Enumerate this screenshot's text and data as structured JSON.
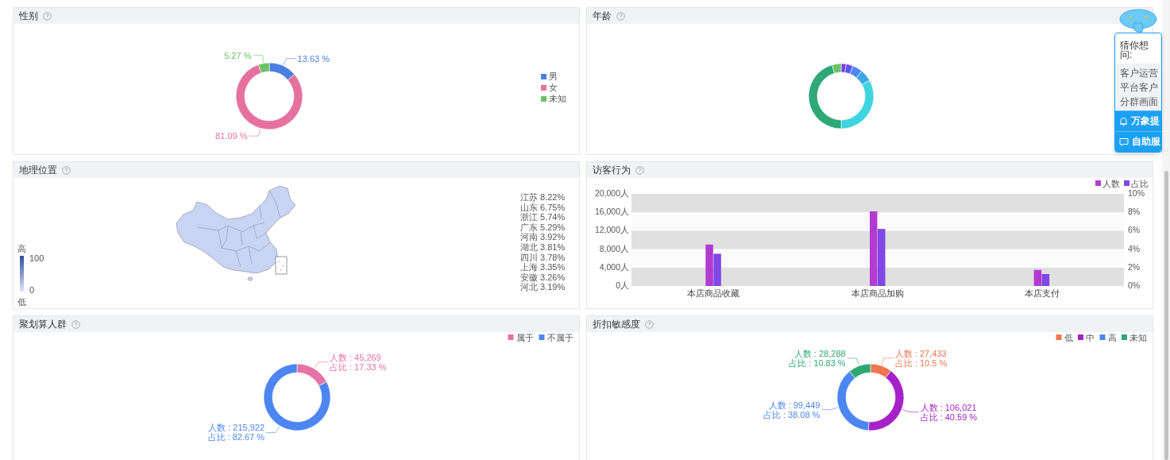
{
  "panels": [
    {
      "kind": "donut",
      "title": "性别",
      "chart_data": {
        "type": "donut",
        "legend": "right",
        "categories": [
          "男",
          "女",
          "未知"
        ],
        "values": [
          13.63,
          81.09,
          5.27
        ],
        "colors": [
          "#4a7fe0",
          "#e6719f",
          "#6cc165"
        ],
        "value_labels": [
          [
            "13.63 %"
          ],
          [
            "81.09 %"
          ],
          [
            "5.27 %"
          ]
        ]
      }
    },
    {
      "kind": "ring",
      "title": "年龄"
    },
    {
      "kind": "map",
      "title": "地理位置",
      "scale": {
        "high": "高",
        "low": "低",
        "max": "100",
        "min": "0"
      },
      "ranking": [
        "江苏 8.22%",
        "山东 6.75%",
        "浙江 5.74%",
        "广东 5.29%",
        "河南 3.92%",
        "湖北 3.81%",
        "四川 3.78%",
        "上海 3.35%",
        "安徽 3.26%",
        "河北 3.19%"
      ]
    },
    {
      "kind": "bar",
      "title": "访客行为",
      "chart_data": {
        "type": "bar",
        "legend": "top-right",
        "categories": [
          "本店商品收藏",
          "本店商品加购",
          "本店支付"
        ],
        "series": [
          {
            "name": "人数",
            "color": "#b23cd3",
            "values": [
              9000,
              16200,
              3500
            ]
          },
          {
            "name": "占比",
            "color": "#8047e6",
            "axis": "y2",
            "values": [
              3.5,
              6.2,
              1.3
            ]
          }
        ],
        "ylim": [
          0,
          20000
        ],
        "yticks": [
          {
            "value": 0,
            "label": "0人"
          },
          {
            "value": 4000,
            "label": "4,000人"
          },
          {
            "value": 8000,
            "label": "8,000人"
          },
          {
            "value": 12000,
            "label": "12,000人"
          },
          {
            "value": 16000,
            "label": "16,000人"
          },
          {
            "value": 20000,
            "label": "20,000人"
          }
        ],
        "y2lim": [
          0,
          10
        ],
        "y2ticks": [
          {
            "value": 0,
            "label": "0%"
          },
          {
            "value": 2,
            "label": "2%"
          },
          {
            "value": 4,
            "label": "4%"
          },
          {
            "value": 6,
            "label": "6%"
          },
          {
            "value": 8,
            "label": "8%"
          },
          {
            "value": 10,
            "label": "10%"
          }
        ]
      }
    },
    {
      "kind": "donut",
      "title": "聚划算人群",
      "chart_data": {
        "type": "donut",
        "legend": "top-right",
        "categories": [
          "属于",
          "不属于"
        ],
        "values": [
          17.33,
          82.67
        ],
        "colors": [
          "#e673a6",
          "#4d86f2"
        ],
        "value_labels": [
          [
            "人数 : 45,269",
            "占比 : 17.33 %"
          ],
          [
            "人数 : 215,922",
            "占比 : 82.67 %"
          ]
        ]
      }
    },
    {
      "kind": "donut",
      "title": "折扣敏感度",
      "chart_data": {
        "type": "donut",
        "legend": "top-right",
        "categories": [
          "低",
          "中",
          "高",
          "未知"
        ],
        "values": [
          10.5,
          40.59,
          38.08,
          10.83
        ],
        "colors": [
          "#f07650",
          "#a522c9",
          "#4d86f2",
          "#2ea872"
        ],
        "value_labels": [
          [
            "人数 : 27,433",
            "占比 : 10.5 %"
          ],
          [
            "人数 : 106,021",
            "占比 : 40.59 %"
          ],
          [
            "人数 : 99,449",
            "占比 : 38.08 %"
          ],
          [
            "人数 : 28,288",
            "占比 : 10.83 %"
          ]
        ]
      }
    }
  ],
  "assistant": {
    "prompt": "猜你想问:",
    "questions": [
      "客户运营",
      "平台客户",
      "分群画面"
    ],
    "actions": [
      {
        "kind": "bell",
        "label": "万象提"
      },
      {
        "kind": "chat",
        "label": "自助服"
      }
    ]
  }
}
